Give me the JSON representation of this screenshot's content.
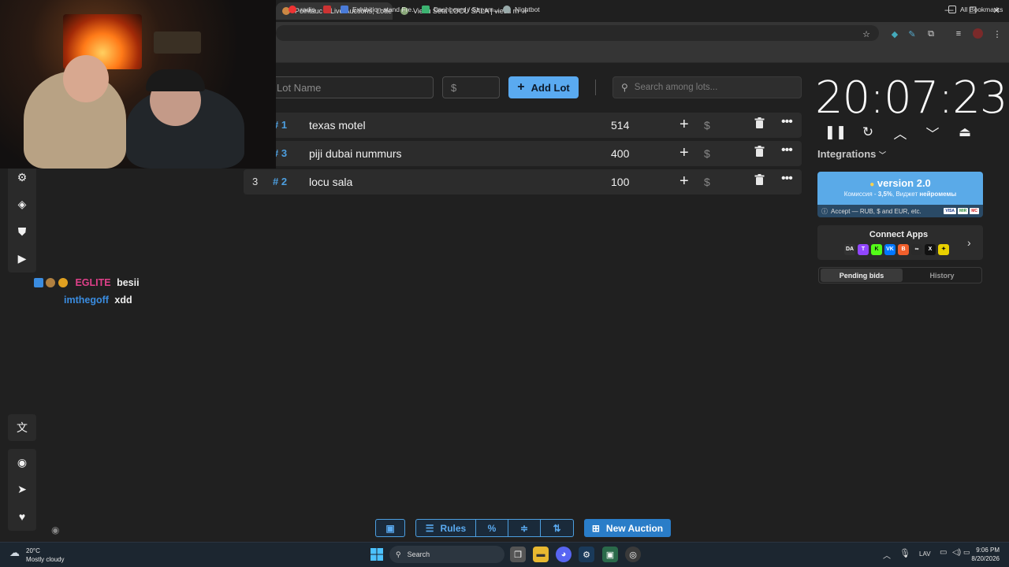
{
  "browser": {
    "tabs": [
      {
        "title": "Pointauc – Live Auctions, Lotte",
        "active": true
      },
      {
        "title": "Viesu Sēta LOCU SALA | viesu m",
        "active": false
      }
    ],
    "new_tab_glyph": "+",
    "bookmarks": [
      {
        "label": "radio",
        "color": "#e33"
      },
      {
        "label": "Exhibition stand Fre...",
        "color": "#4a7bd8"
      },
      {
        "label": "Dashboard / Stream...",
        "color": "#3cb371"
      },
      {
        "label": "Nightbot",
        "color": "#9aa"
      }
    ],
    "all_bookmarks": "All Bookmarks",
    "window_controls": [
      "—",
      "❐",
      "✕"
    ]
  },
  "lot_form": {
    "name_placeholder": "Lot Name",
    "amount_placeholder": "$",
    "add_lot_label": "Add Lot",
    "search_placeholder": "Search among lots..."
  },
  "lots": [
    {
      "index": "",
      "hash": "# 1",
      "name": "texas motel",
      "amount": "514",
      "dollar": "$"
    },
    {
      "index": "",
      "hash": "# 3",
      "name": "piji dubai nummurs",
      "amount": "400",
      "dollar": "$"
    },
    {
      "index": "3",
      "hash": "# 2",
      "name": "locu sala",
      "amount": "100",
      "dollar": "$"
    }
  ],
  "timer": {
    "display": "20:07:23",
    "controls": [
      "pause-icon",
      "restart-icon",
      "increase-icon",
      "decrease-icon",
      "eject-icon"
    ]
  },
  "integrations_label": "Integrations",
  "version_card": {
    "title": "version 2.0",
    "subtitle_prefix": "Комиссия - ",
    "subtitle_pct": "3,5%",
    "subtitle_mid": ", Виджет ",
    "subtitle_bold": "нейромемы",
    "accept_text": "Accept — RUB, $ and EUR, etc.",
    "payment_badges": [
      "VISA",
      "MIR",
      "MC"
    ]
  },
  "connect_apps": {
    "title": "Connect Apps",
    "icons": [
      {
        "name": "donationalerts-icon",
        "label": "DA",
        "color": "#333"
      },
      {
        "name": "twitch-icon",
        "label": "T",
        "color": "#9146ff"
      },
      {
        "name": "kick-icon",
        "label": "K",
        "color": "#53fc18"
      },
      {
        "name": "vk-icon",
        "label": "VK",
        "color": "#0077ff"
      },
      {
        "name": "boosty-icon",
        "label": "B",
        "color": "#f15f2c"
      },
      {
        "name": "link-icon",
        "label": "∞",
        "color": "#2a2a2a"
      },
      {
        "name": "x-icon",
        "label": "X",
        "color": "#111"
      },
      {
        "name": "yellow-app-icon",
        "label": "✦",
        "color": "#e8d000"
      }
    ]
  },
  "bids_tabs": {
    "pending": "Pending bids",
    "history": "History"
  },
  "chat": [
    {
      "user": "EGLITE",
      "user_color": "#e0408a",
      "message": "besii"
    },
    {
      "user": "imthegoff",
      "user_color": "#3a8ce0",
      "message": "xdd"
    }
  ],
  "toolbar": {
    "rules_label": "Rules",
    "new_auction_label": "New Auction"
  },
  "taskbar": {
    "weather_temp": "20°C",
    "weather_desc": "Mostly cloudy",
    "search_label": "Search",
    "lang": "LAV",
    "time": "9:06 PM",
    "date": "8/20/2026"
  },
  "colors": {
    "accent": "#5aaaf0",
    "hash_blue": "#4d9fe0",
    "row_bg": "#2c2c2c",
    "bg": "#202020"
  }
}
